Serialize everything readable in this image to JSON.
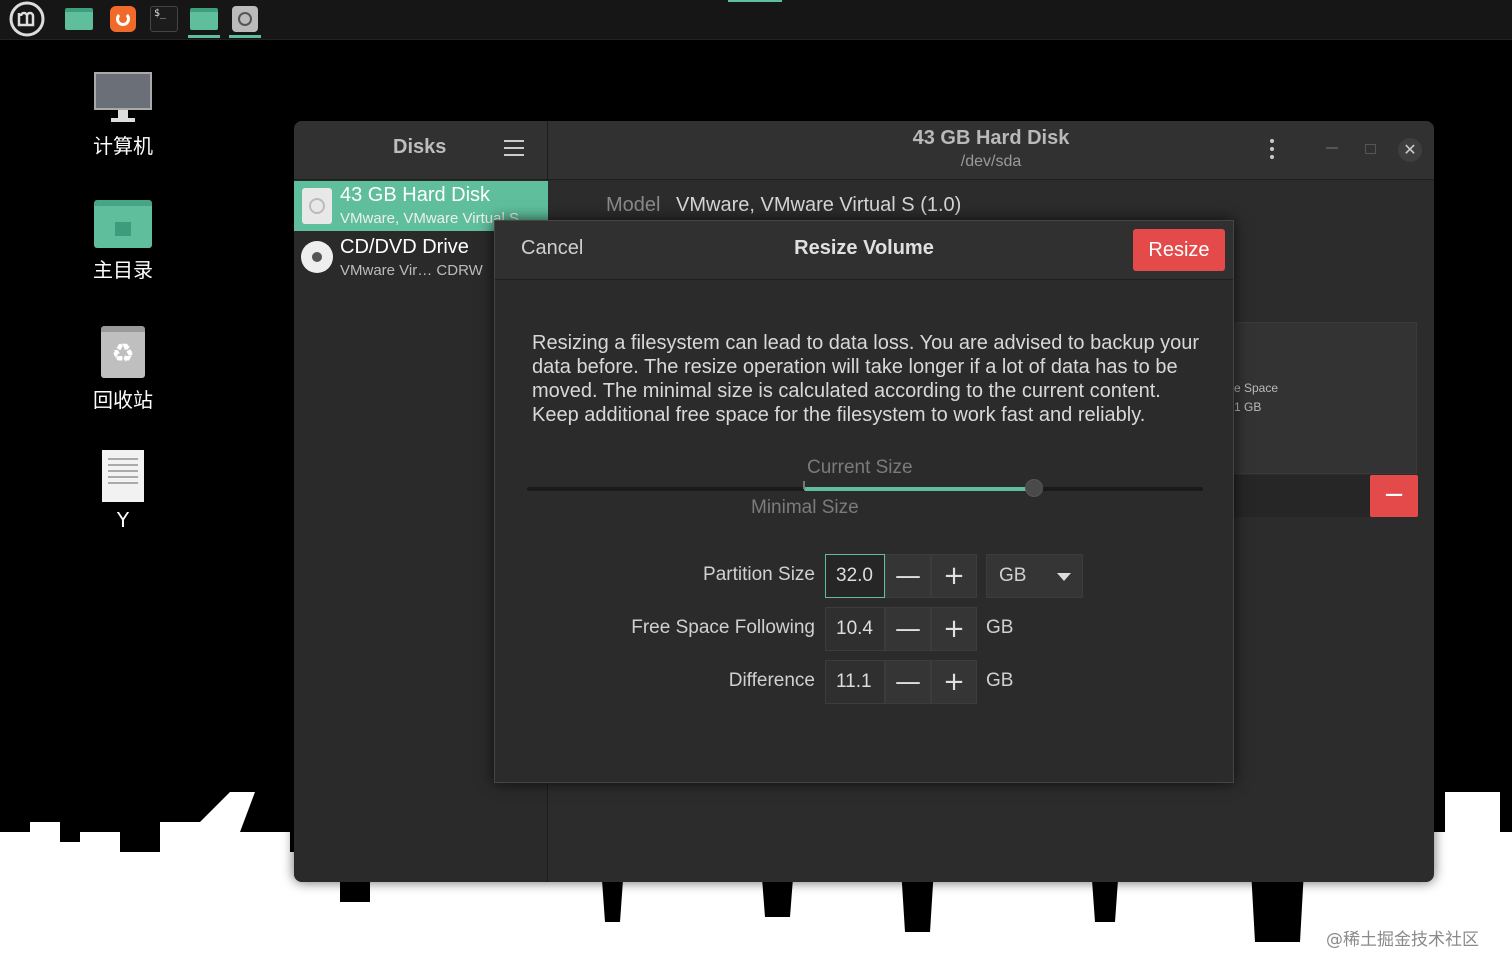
{
  "desktop": {
    "icons": [
      {
        "label": "计算机"
      },
      {
        "label": "主目录"
      },
      {
        "label": "回收站"
      },
      {
        "label": "Y"
      }
    ]
  },
  "disks": {
    "sidebar_title": "Disks",
    "devices": [
      {
        "name": "43 GB Hard Disk",
        "sub": "VMware, VMware Virtual S"
      },
      {
        "name": "CD/DVD Drive",
        "sub": "VMware Vir… CDRW"
      }
    ],
    "header_title": "43 GB Hard Disk",
    "header_subtitle": "/dev/sda",
    "model_label": "Model",
    "model_value": "VMware, VMware Virtual S (1.0)",
    "bg_volume_line1": "e Space",
    "bg_volume_line2": "1 GB",
    "window_close": "✕",
    "bg_minus": "−"
  },
  "dialog": {
    "cancel": "Cancel",
    "title": "Resize Volume",
    "resize": "Resize",
    "warning": "Resizing a filesystem can lead to data loss. You are advised to backup your data before. The resize operation will take longer if a lot of data has to be moved. The minimal size is calculated according to the current content. Keep additional free space for the filesystem to work fast and reliably.",
    "slider": {
      "current_label": "Current Size",
      "minimal_label": "Minimal Size",
      "minimal_fraction": 0.41,
      "current_fraction": 0.75
    },
    "fields": {
      "partition_size": {
        "label": "Partition Size",
        "value": "32.0",
        "unit": "GB"
      },
      "free_space": {
        "label": "Free Space Following",
        "value": "10.4",
        "unit": "GB"
      },
      "difference": {
        "label": "Difference",
        "value": "11.1",
        "unit": "GB"
      }
    },
    "minus": "—",
    "plus": "+"
  },
  "watermark": "@稀土掘金技术社区",
  "colors": {
    "accent": "#5fbf9d",
    "destructive": "#e54a4a"
  }
}
